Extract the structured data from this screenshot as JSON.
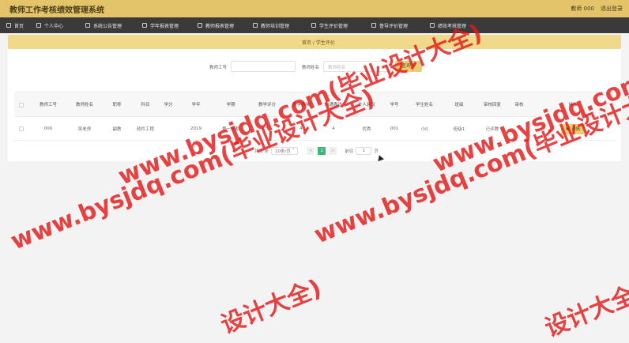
{
  "app": {
    "title": "教师工作考核绩效管理系统"
  },
  "header": {
    "user_label": "教师 000",
    "logout_label": "退出登录"
  },
  "nav": {
    "items": [
      {
        "label": "首页"
      },
      {
        "label": "个人中心"
      },
      {
        "label": "系统公告管理"
      },
      {
        "label": "学年报表管理"
      },
      {
        "label": "教师报表管理"
      },
      {
        "label": "教师培训管理"
      },
      {
        "label": "学生评价管理"
      },
      {
        "label": "督导评价管理"
      },
      {
        "label": "绩效考核管理"
      }
    ]
  },
  "breadcrumb": {
    "text": "首页 / 学生评价"
  },
  "search": {
    "teacher_id_label": "教师工号",
    "teacher_id_value": "",
    "teacher_name_label": "教师姓名",
    "teacher_name_placeholder": "教师姓名",
    "button_label": "查询"
  },
  "table": {
    "headers": [
      "教师工号",
      "教师姓名",
      "职称",
      "科目",
      "学分",
      "学年",
      "学期",
      "教学评分",
      "教学趣味",
      "沟通表达",
      "个人建议",
      "学号",
      "学生姓名",
      "班级",
      "审核回复",
      "审核",
      "操作"
    ],
    "rows": [
      {
        "cells": [
          "000",
          "吴老师",
          "副教",
          "软件工程",
          "",
          "2019",
          "第一学期",
          "5",
          "4",
          "4",
          "优秀",
          "001",
          "小II",
          "班级1",
          "已评教",
          ""
        ],
        "action_label": "详情"
      }
    ]
  },
  "pagination": {
    "total": "共 1 条",
    "page_size": "10条/页",
    "prev": "<",
    "current": "1",
    "next": ">",
    "goto_label": "前往",
    "goto_value": "1",
    "page_suffix": "页"
  },
  "watermark": {
    "text": "www.bysjdq.com(毕业设计大全)",
    "fragment": "设计大全)"
  },
  "colors": {
    "topbar": "#e3c46b",
    "nav": "#3a3a3a",
    "accent": "#e9cc74",
    "page_active": "#3cb878",
    "watermark": "#e21a1a"
  }
}
